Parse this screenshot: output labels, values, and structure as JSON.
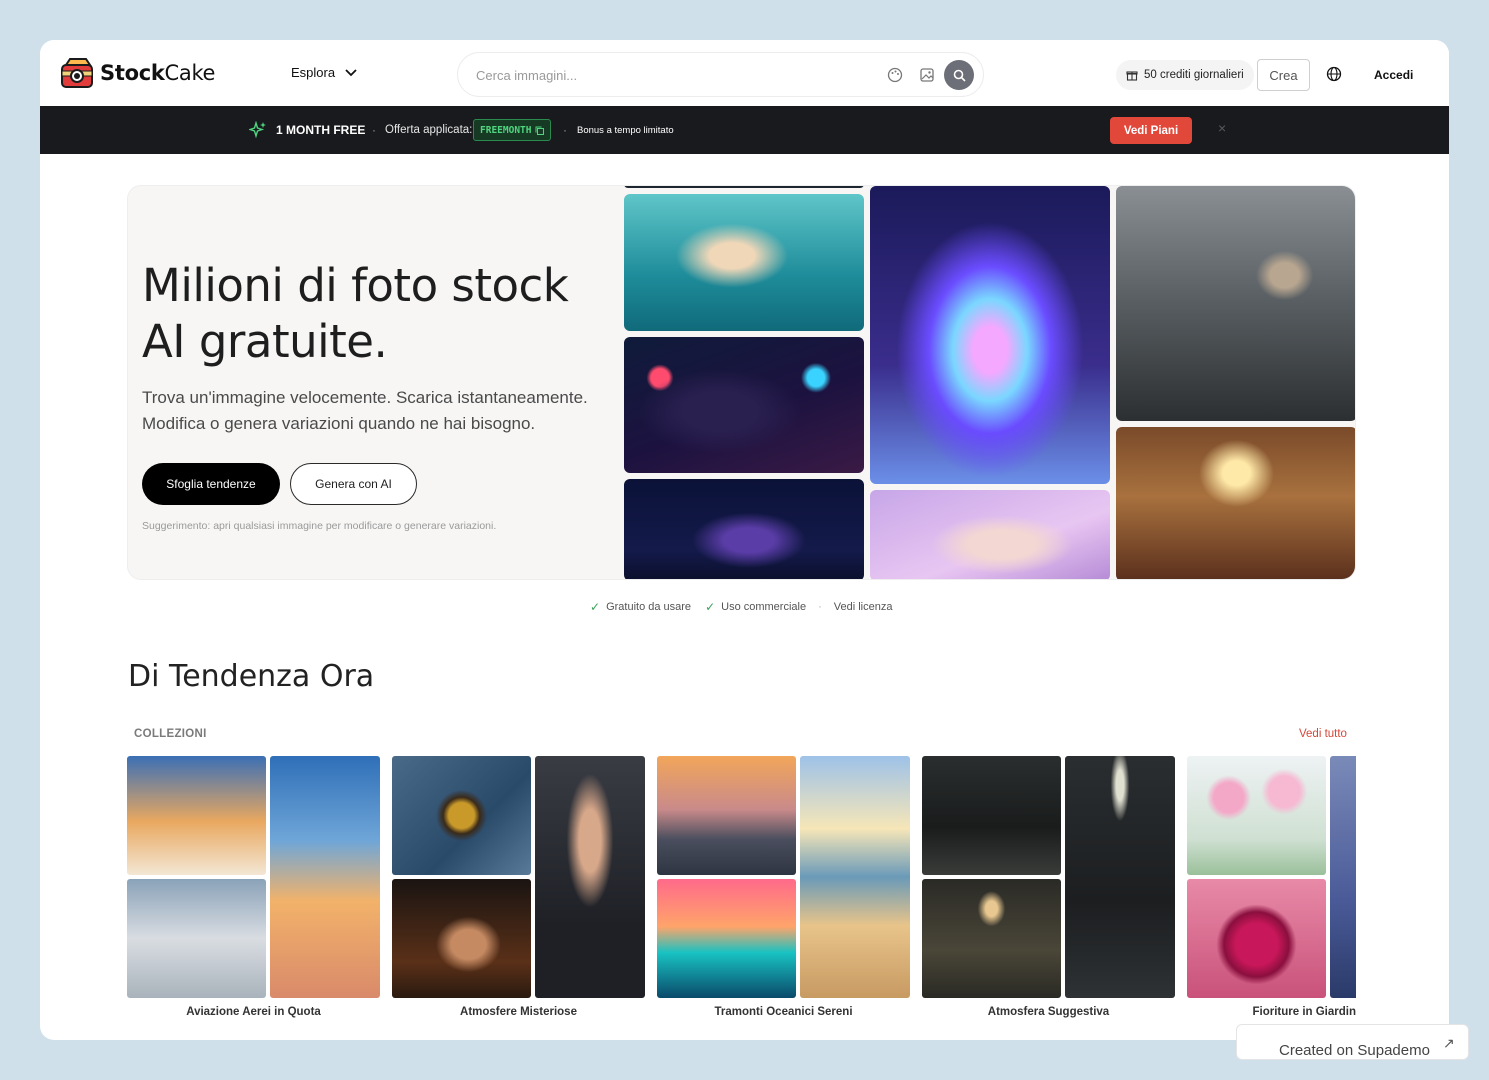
{
  "header": {
    "logo_text_bold": "Stock",
    "logo_text_rest": "Cake",
    "explore_label": "Esplora",
    "search_placeholder": "Cerca immagini...",
    "credits_label": "50 crediti giornalieri",
    "create_label": "Crea",
    "login_label": "Accedi"
  },
  "promo": {
    "title": "1 MONTH FREE",
    "applied_label": "Offerta applicata:",
    "code": "FREEMONTH",
    "bonus": "Bonus a tempo limitato",
    "cta": "Vedi Piani",
    "close": "×"
  },
  "hero": {
    "title_line1": "Milioni di foto stock",
    "title_line2": "AI gratuite.",
    "subtitle": "Trova un'immagine velocemente. Scarica istantaneamente. Modifica o genera variazioni quando ne hai bisogno.",
    "primary_cta": "Sfoglia tendenze",
    "secondary_cta": "Genera con AI",
    "hint": "Suggerimento: apri qualsiasi immagine per modificare o generare variazioni."
  },
  "license": {
    "free": "Gratuito da usare",
    "commercial": "Uso commerciale",
    "view": "Vedi licenza"
  },
  "trending": {
    "title": "Di Tendenza Ora",
    "collections_label": "COLLEZIONI",
    "see_all": "Vedi tutto",
    "collections": [
      {
        "name": "Aviazione Aerei in Quota"
      },
      {
        "name": "Atmosfere Misteriose"
      },
      {
        "name": "Tramonti Oceanici Sereni"
      },
      {
        "name": "Atmosfera Suggestiva"
      },
      {
        "name": "Fioriture in Giardin"
      }
    ]
  },
  "badge": {
    "label": "Created on Supademo",
    "arrow": "↗"
  },
  "colors": {
    "accent_red": "#e2483a",
    "promo_bg": "#191a1e",
    "code_green": "#4fd57f"
  }
}
